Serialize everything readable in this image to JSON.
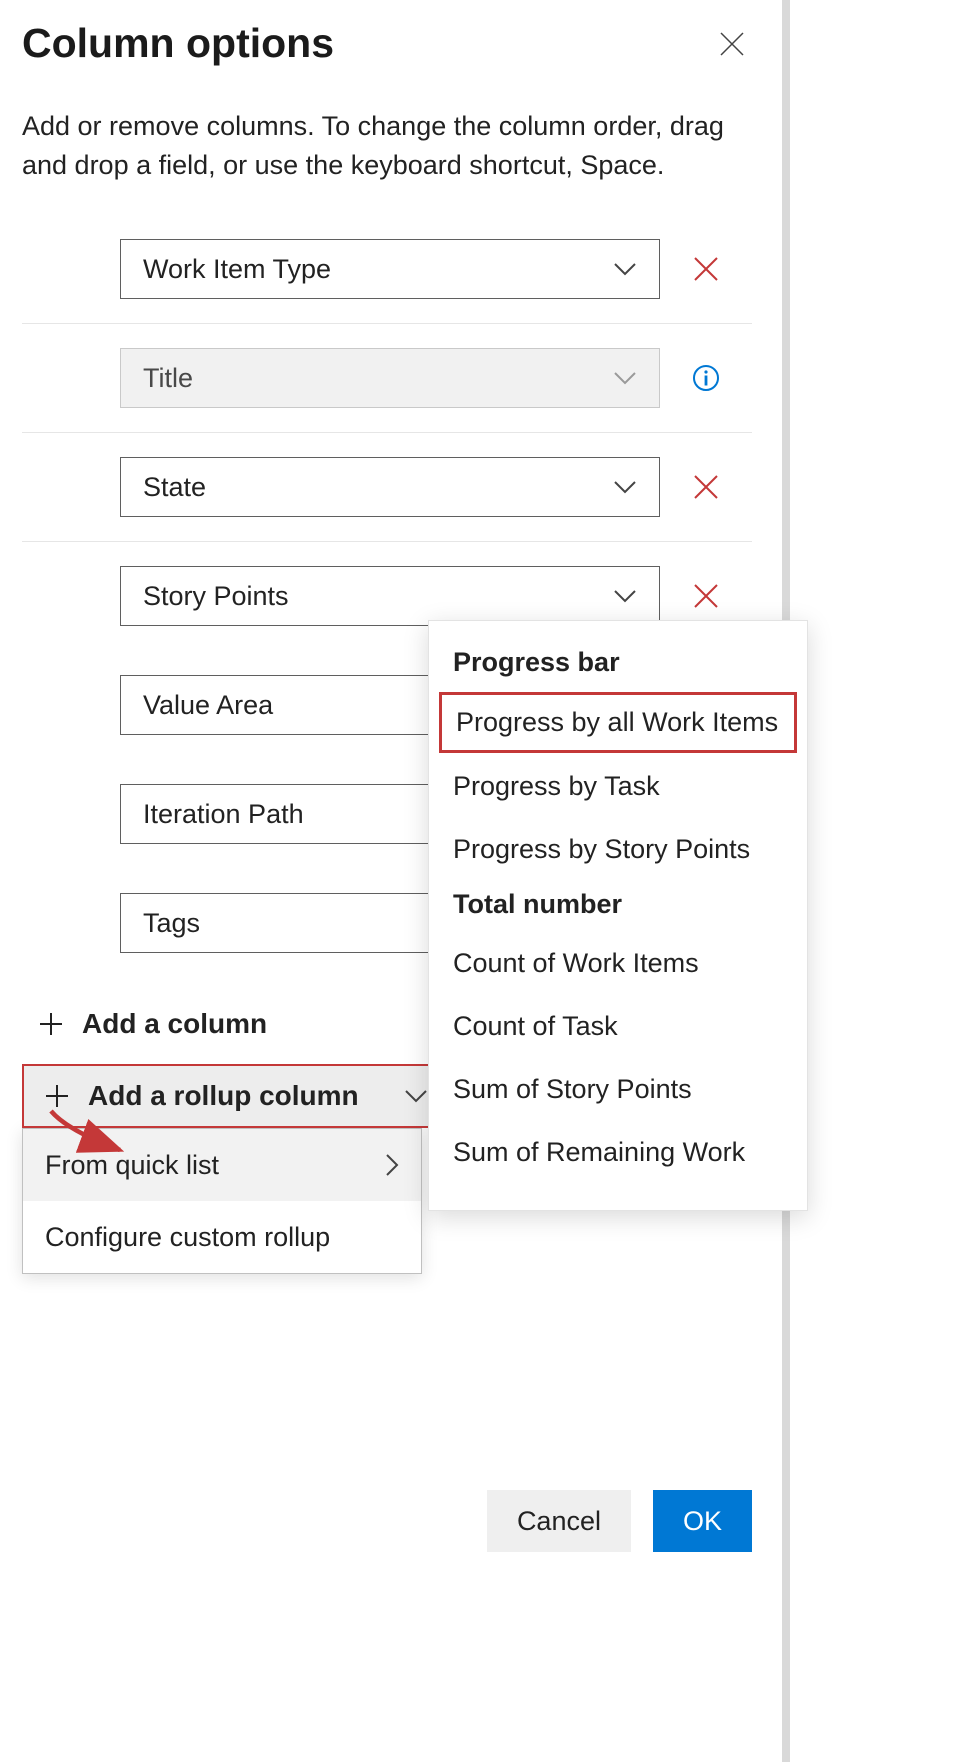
{
  "panel": {
    "title": "Column options",
    "description": "Add or remove columns. To change the column order, drag and drop a field, or use the keyboard shortcut, Space.",
    "columns": [
      {
        "label": "Work Item Type",
        "action": "remove",
        "disabled": false
      },
      {
        "label": "Title",
        "action": "info",
        "disabled": true
      },
      {
        "label": "State",
        "action": "remove",
        "disabled": false
      },
      {
        "label": "Story Points",
        "action": "remove",
        "disabled": false
      },
      {
        "label": "Value Area",
        "action": "remove",
        "disabled": false
      },
      {
        "label": "Iteration Path",
        "action": "remove",
        "disabled": false
      },
      {
        "label": "Tags",
        "action": "remove",
        "disabled": false
      }
    ],
    "add_column_label": "Add a column",
    "add_rollup_label": "Add a rollup column",
    "rollup_menu": {
      "from_quick_list": "From quick list",
      "configure_custom": "Configure custom rollup"
    },
    "flyout": {
      "group1_header": "Progress bar",
      "group1_items": [
        "Progress by all Work Items",
        "Progress by Task",
        "Progress by Story Points"
      ],
      "group2_header": "Total number",
      "group2_items": [
        "Count of Work Items",
        "Count of Task",
        "Sum of Story Points",
        "Sum of Remaining Work"
      ],
      "selected": "Progress by all Work Items"
    },
    "footer": {
      "cancel": "Cancel",
      "ok": "OK"
    }
  }
}
